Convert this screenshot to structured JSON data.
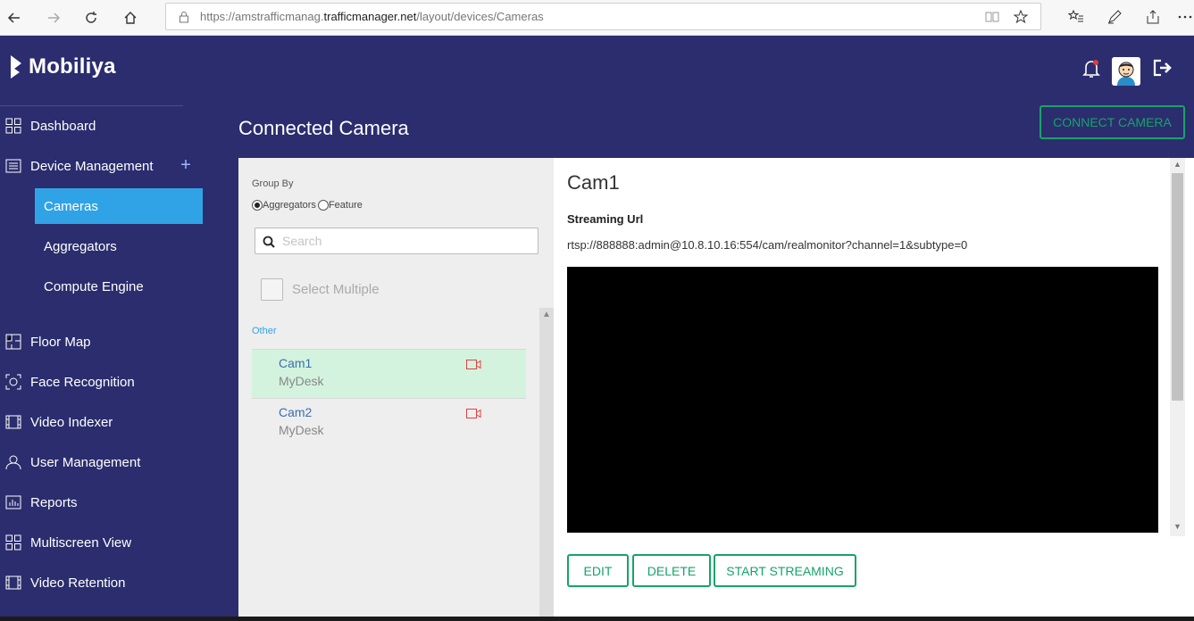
{
  "browser": {
    "url_prefix": "https://amstrafficmanag.",
    "url_host": "trafficmanager.net",
    "url_path": "/layout/devices/Cameras"
  },
  "brand": {
    "name": "Mobiliya"
  },
  "sidebar": {
    "items": [
      {
        "label": "Dashboard",
        "icon": "grid-icon"
      },
      {
        "label": "Device Management",
        "icon": "list-icon"
      },
      {
        "label": "Floor Map",
        "icon": "floor-map-icon"
      },
      {
        "label": "Face Recognition",
        "icon": "face-scan-icon"
      },
      {
        "label": "Video Indexer",
        "icon": "film-icon"
      },
      {
        "label": "User Management",
        "icon": "user-icon"
      },
      {
        "label": "Reports",
        "icon": "chart-icon"
      },
      {
        "label": "Multiscreen View",
        "icon": "grid-icon"
      },
      {
        "label": "Video Retention",
        "icon": "film-icon"
      }
    ],
    "subitems": [
      {
        "label": "Cameras",
        "active": true
      },
      {
        "label": "Aggregators",
        "active": false
      },
      {
        "label": "Compute Engine",
        "active": false
      }
    ],
    "expand_symbol": "+"
  },
  "page": {
    "title": "Connected Camera",
    "connect_button": "CONNECT CAMERA"
  },
  "list": {
    "group_by_label": "Group By",
    "radio_aggregators": "Aggregators",
    "radio_feature": "Feature",
    "search_placeholder": "Search",
    "select_multiple": "Select Multiple",
    "group_label": "Other",
    "cameras": [
      {
        "name": "Cam1",
        "location": "MyDesk",
        "selected": true
      },
      {
        "name": "Cam2",
        "location": "MyDesk",
        "selected": false
      }
    ]
  },
  "detail": {
    "title": "Cam1",
    "streaming_label": "Streaming Url",
    "streaming_url": "rtsp://888888:admin@10.8.10.16:554/cam/realmonitor?channel=1&subtype=0",
    "buttons": {
      "edit": "EDIT",
      "delete": "DELETE",
      "start": "START STREAMING"
    }
  },
  "colors": {
    "background": "#2b2d6e",
    "accent_blue": "#30a3e6",
    "accent_green": "#16a36a",
    "selected_row": "#d3f3df"
  }
}
